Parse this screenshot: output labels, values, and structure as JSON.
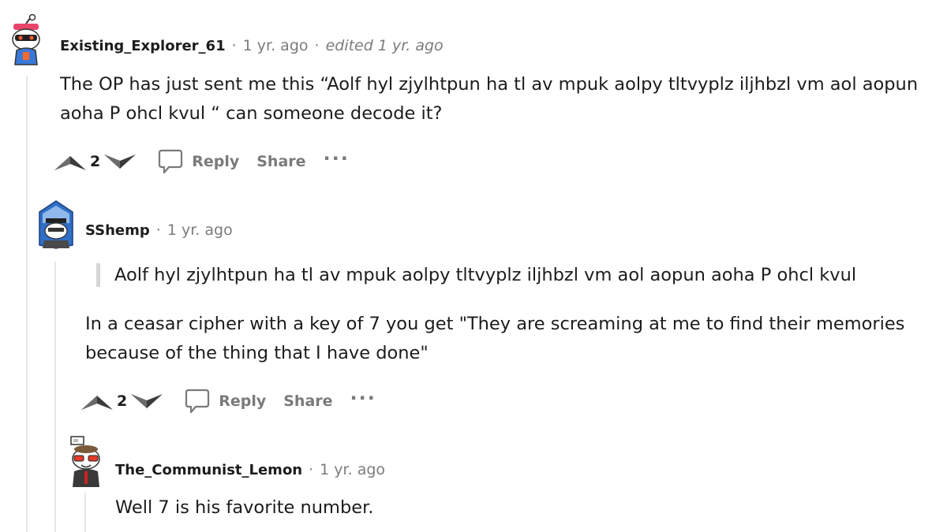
{
  "comments": [
    {
      "username": "Existing_Explorer_61",
      "time": "1 yr. ago",
      "edited": "edited 1 yr. ago",
      "body": "The OP has just sent me this “Aolf hyl zjylhtpun ha tl av mpuk aolpy tltvyplz iljhbzl vm aol aopun aoha P ohcl kvul “ can someone decode it?",
      "score": "2",
      "reply_label": "Reply",
      "share_label": "Share",
      "more_label": "···"
    },
    {
      "username": "SShemp",
      "time": "1 yr. ago",
      "quote": "Aolf hyl zjylhtpun ha tl av mpuk aolpy tltvyplz iljhbzl vm aol aopun aoha P ohcl kvul",
      "body": "In a ceasar cipher with a key of 7 you get \"They are screaming at me to find their memories because of the thing that I have done\"",
      "score": "2",
      "reply_label": "Reply",
      "share_label": "Share",
      "more_label": "···"
    },
    {
      "username": "The_Communist_Lemon",
      "time": "1 yr. ago",
      "body": "Well 7 is his favorite number."
    }
  ],
  "separator": "·",
  "colors": {
    "text": "#1c1c1c",
    "meta": "#7c7c7c",
    "action": "#7a7a7a",
    "thread_line": "#e6e6e6",
    "quote_bar": "#d6d6d6"
  }
}
